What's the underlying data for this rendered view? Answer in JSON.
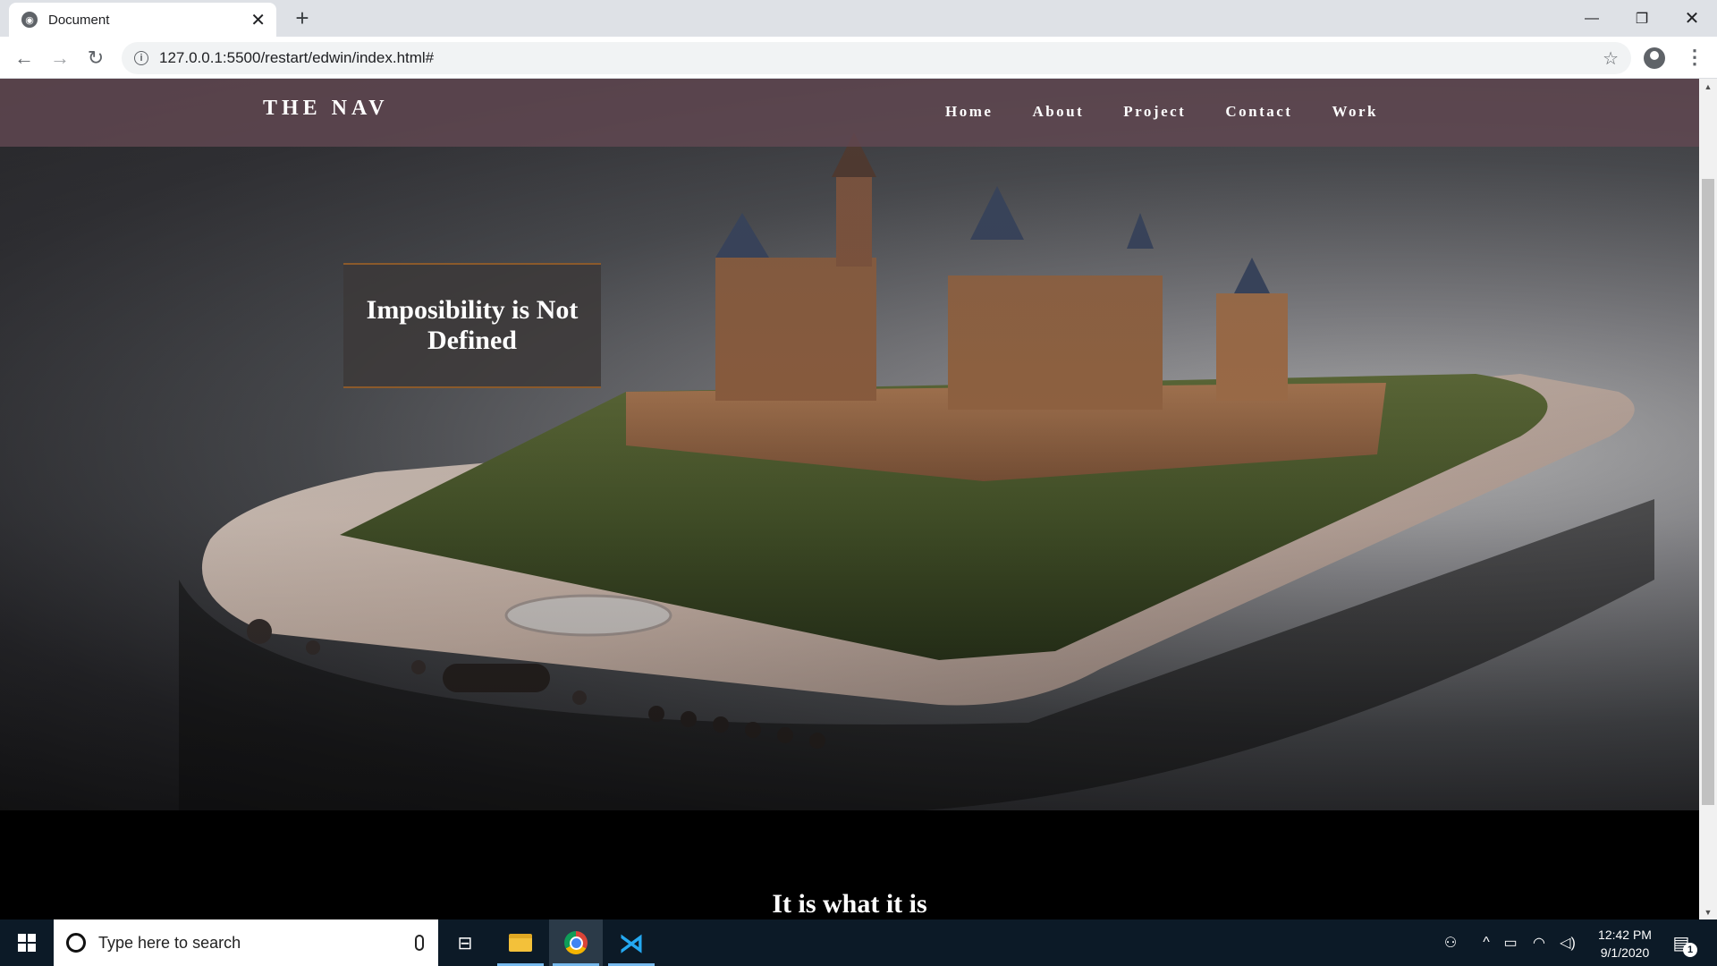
{
  "browser": {
    "tab_title": "Document",
    "tab_close": "✕",
    "new_tab": "+",
    "url": "127.0.0.1:5500/restart/edwin/index.html#",
    "window_min": "—",
    "window_max": "❐",
    "window_close": "✕"
  },
  "page": {
    "brand": "THE NAV",
    "nav_links": [
      "Home",
      "About",
      "Project",
      "Contact",
      "Work"
    ],
    "tagline": "Imposibility is Not Defined",
    "section_heading": "It is what it is"
  },
  "taskbar": {
    "search_placeholder": "Type here to search",
    "time": "12:42 PM",
    "date": "9/1/2020",
    "notification_count": "1"
  },
  "colors": {
    "navbar": "#624852",
    "accent_border": "#8b5a2b",
    "taskbar": "#0c1a27"
  },
  "icons": [
    "globe-icon",
    "back-arrow-icon",
    "forward-arrow-icon",
    "reload-icon",
    "info-icon",
    "star-icon",
    "profile-icon",
    "menu-icon",
    "windows-icon",
    "search-circle-icon",
    "mic-icon",
    "task-view-icon",
    "file-explorer-icon",
    "chrome-icon",
    "vscode-icon",
    "people-icon",
    "chevron-up-icon",
    "battery-icon",
    "wifi-icon",
    "volume-icon",
    "notification-icon"
  ]
}
